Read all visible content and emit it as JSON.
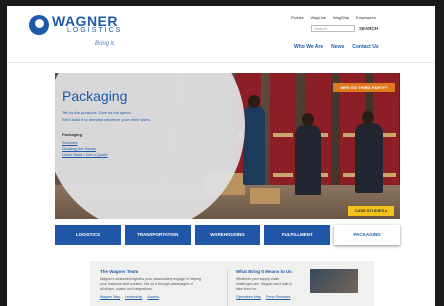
{
  "header": {
    "brand_name": "WAGNER",
    "brand_sub": "LOGISTICS",
    "tagline": "Bring it.",
    "utility_links": [
      "Portals",
      "WagLink",
      "WagShip",
      "Employees"
    ],
    "search_placeholder": "Search...",
    "search_button": "SEARCH",
    "main_nav": [
      "Who We Are",
      "News",
      "Contact Us"
    ]
  },
  "hero": {
    "title": "Packaging",
    "text_lines": [
      "Tell us the products. Give us the specs.",
      "We'll build it to demand whatever your drive sales."
    ],
    "list_heading": "Packaging",
    "links": [
      "Services",
      "Growing the Sense",
      "Learn More / Get a Quote"
    ],
    "third_party_button": "WHY GO THIRD-PARTY?",
    "case_studies_button": "CASE STUDIES ▸"
  },
  "tabs": [
    {
      "label": "LOGISTICS",
      "active": false
    },
    {
      "label": "TRANSPORTATION",
      "active": false
    },
    {
      "label": "WAREHOUSING",
      "active": false
    },
    {
      "label": "FULFILLMENT",
      "active": false
    },
    {
      "label": "PACKAGING",
      "active": true
    }
  ],
  "panels": {
    "left": {
      "title": "The Wagner Team",
      "body_lines": [
        "Wagner's seasoned logistics pros passionately engage in helping",
        "your business best solution. We do it through advantages of",
        "all shape, scales and integrations."
      ],
      "links": [
        "Wagner Way",
        "Leadership",
        "Awards"
      ]
    },
    "right": {
      "title": "What Bring It Means to Us",
      "body_lines": [
        "Whatever your supply chain",
        "challenges are, Wagner can't wait to",
        "take them on."
      ],
      "links": [
        "Operations Map",
        "Press Releases"
      ]
    }
  },
  "colors": {
    "brand_blue": "#1d5ba8",
    "tab_blue": "#1f56a8",
    "orange": "#e07a1f",
    "yellow": "#f2c21b"
  }
}
